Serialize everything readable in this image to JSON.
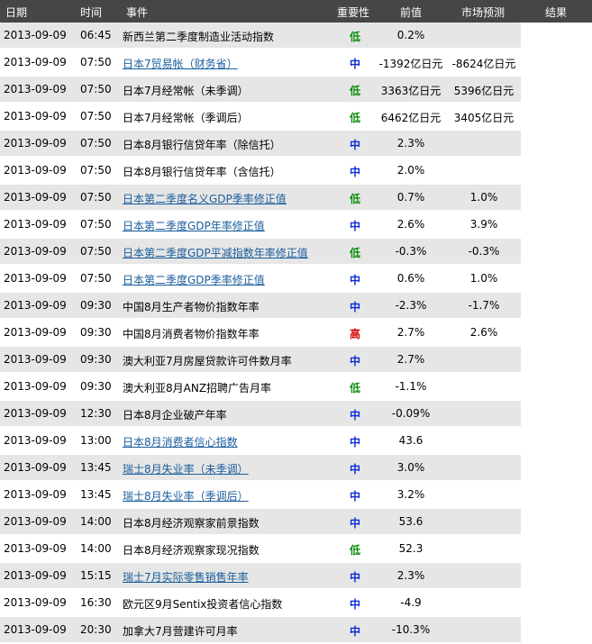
{
  "header": {
    "date": "日期",
    "time": "时间",
    "event": "事件",
    "importance": "重要性",
    "previous": "前值",
    "forecast": "市场预测",
    "result": "结果"
  },
  "colors": {
    "header_bg": "#464646",
    "row_shade": "#e6e6e6",
    "link": "#1a5d9c",
    "importance_low": "#0a8f0a",
    "importance_mid": "#0a2bd6",
    "importance_high": "#d40000"
  },
  "rows": [
    {
      "date": "2013-09-09",
      "time": "06:45",
      "event": "新西兰第二季度制造业活动指数",
      "link": false,
      "importance": "低",
      "level": "low",
      "previous": "0.2%",
      "forecast": "",
      "result": ""
    },
    {
      "date": "2013-09-09",
      "time": "07:50",
      "event": "日本7贸易帐（财务省）",
      "link": true,
      "importance": "中",
      "level": "mid",
      "previous": "-1392亿日元",
      "forecast": "-8624亿日元",
      "result": ""
    },
    {
      "date": "2013-09-09",
      "time": "07:50",
      "event": "日本7月经常帐（未季调）",
      "link": false,
      "importance": "低",
      "level": "low",
      "previous": "3363亿日元",
      "forecast": "5396亿日元",
      "result": ""
    },
    {
      "date": "2013-09-09",
      "time": "07:50",
      "event": "日本7月经常帐（季调后）",
      "link": false,
      "importance": "低",
      "level": "low",
      "previous": "6462亿日元",
      "forecast": "3405亿日元",
      "result": ""
    },
    {
      "date": "2013-09-09",
      "time": "07:50",
      "event": "日本8月银行信贷年率（除信托）",
      "link": false,
      "importance": "中",
      "level": "mid",
      "previous": "2.3%",
      "forecast": "",
      "result": ""
    },
    {
      "date": "2013-09-09",
      "time": "07:50",
      "event": "日本8月银行信贷年率（含信托）",
      "link": false,
      "importance": "中",
      "level": "mid",
      "previous": "2.0%",
      "forecast": "",
      "result": ""
    },
    {
      "date": "2013-09-09",
      "time": "07:50",
      "event": "日本第二季度名义GDP季率修正值",
      "link": true,
      "importance": "低",
      "level": "low",
      "previous": "0.7%",
      "forecast": "1.0%",
      "result": ""
    },
    {
      "date": "2013-09-09",
      "time": "07:50",
      "event": "日本第二季度GDP年率修正值",
      "link": true,
      "importance": "中",
      "level": "mid",
      "previous": "2.6%",
      "forecast": "3.9%",
      "result": ""
    },
    {
      "date": "2013-09-09",
      "time": "07:50",
      "event": "日本第二季度GDP平减指数年率修正值",
      "link": true,
      "importance": "低",
      "level": "low",
      "previous": "-0.3%",
      "forecast": "-0.3%",
      "result": ""
    },
    {
      "date": "2013-09-09",
      "time": "07:50",
      "event": "日本第二季度GDP季率修正值",
      "link": true,
      "importance": "中",
      "level": "mid",
      "previous": "0.6%",
      "forecast": "1.0%",
      "result": ""
    },
    {
      "date": "2013-09-09",
      "time": "09:30",
      "event": "中国8月生产者物价指数年率",
      "link": false,
      "importance": "中",
      "level": "mid",
      "previous": "-2.3%",
      "forecast": "-1.7%",
      "result": ""
    },
    {
      "date": "2013-09-09",
      "time": "09:30",
      "event": "中国8月消费者物价指数年率",
      "link": false,
      "importance": "高",
      "level": "high",
      "previous": "2.7%",
      "forecast": "2.6%",
      "result": ""
    },
    {
      "date": "2013-09-09",
      "time": "09:30",
      "event": "澳大利亚7月房屋贷款许可件数月率",
      "link": false,
      "importance": "中",
      "level": "mid",
      "previous": "2.7%",
      "forecast": "",
      "result": ""
    },
    {
      "date": "2013-09-09",
      "time": "09:30",
      "event": "澳大利亚8月ANZ招聘广告月率",
      "link": false,
      "importance": "低",
      "level": "low",
      "previous": "-1.1%",
      "forecast": "",
      "result": ""
    },
    {
      "date": "2013-09-09",
      "time": "12:30",
      "event": "日本8月企业破产年率",
      "link": false,
      "importance": "中",
      "level": "mid",
      "previous": "-0.09%",
      "forecast": "",
      "result": ""
    },
    {
      "date": "2013-09-09",
      "time": "13:00",
      "event": "日本8月消费者信心指数",
      "link": true,
      "importance": "中",
      "level": "mid",
      "previous": "43.6",
      "forecast": "",
      "result": ""
    },
    {
      "date": "2013-09-09",
      "time": "13:45",
      "event": "瑞士8月失业率（未季调）",
      "link": true,
      "importance": "中",
      "level": "mid",
      "previous": "3.0%",
      "forecast": "",
      "result": ""
    },
    {
      "date": "2013-09-09",
      "time": "13:45",
      "event": "瑞士8月失业率（季调后）",
      "link": true,
      "importance": "中",
      "level": "mid",
      "previous": "3.2%",
      "forecast": "",
      "result": ""
    },
    {
      "date": "2013-09-09",
      "time": "14:00",
      "event": "日本8月经济观察家前景指数",
      "link": false,
      "importance": "中",
      "level": "mid",
      "previous": "53.6",
      "forecast": "",
      "result": ""
    },
    {
      "date": "2013-09-09",
      "time": "14:00",
      "event": "日本8月经济观察家现况指数",
      "link": false,
      "importance": "低",
      "level": "low",
      "previous": "52.3",
      "forecast": "",
      "result": ""
    },
    {
      "date": "2013-09-09",
      "time": "15:15",
      "event": "瑞士7月实际零售销售年率",
      "link": true,
      "importance": "中",
      "level": "mid",
      "previous": "2.3%",
      "forecast": "",
      "result": ""
    },
    {
      "date": "2013-09-09",
      "time": "16:30",
      "event": "欧元区9月Sentix投资者信心指数",
      "link": false,
      "importance": "中",
      "level": "mid",
      "previous": "-4.9",
      "forecast": "",
      "result": ""
    },
    {
      "date": "2013-09-09",
      "time": "20:30",
      "event": "加拿大7月营建许可月率",
      "link": false,
      "importance": "中",
      "level": "mid",
      "previous": "-10.3%",
      "forecast": "",
      "result": ""
    }
  ]
}
